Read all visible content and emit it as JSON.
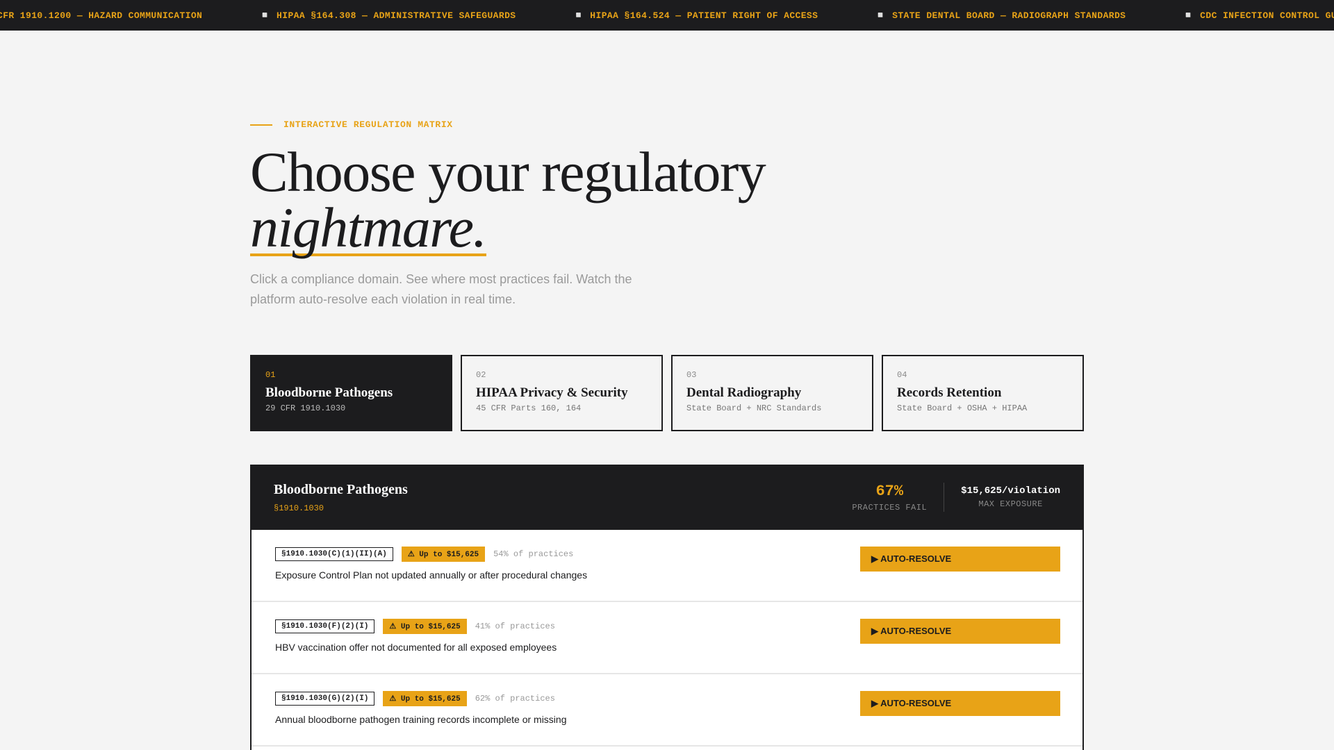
{
  "ticker": {
    "items": [
      "CFR 1910.1200 — HAZARD COMMUNICATION",
      "◽ HIPAA §164.308 — ADMINISTRATIVE SAFEGUARDS",
      "◽ HIPAA §164.524 — PATIENT RIGHT OF ACCESS",
      "◽ STATE DENTAL BOARD — RADIOGRAPH STANDARDS",
      "◽ CDC INFECTION CONTROL GU"
    ]
  },
  "hero": {
    "eyebrow": "INTERACTIVE REGULATION MATRIX",
    "headline_line1": "Choose your regulatory",
    "headline_line2": "nightmare.",
    "subtitle": "Click a compliance domain. See where most practices fail. Watch the platform auto-resolve each violation in real time."
  },
  "tabs": [
    {
      "num": "01",
      "name": "Bloodborne Pathogens",
      "cite": "29 CFR 1910.1030",
      "active": true
    },
    {
      "num": "02",
      "name": "HIPAA Privacy & Security",
      "cite": "45 CFR Parts 160, 164",
      "active": false
    },
    {
      "num": "03",
      "name": "Dental Radiography",
      "cite": "State Board + NRC Standards",
      "active": false
    },
    {
      "num": "04",
      "name": "Records Retention",
      "cite": "State Board + OSHA + HIPAA",
      "active": false
    }
  ],
  "panel": {
    "title": "Bloodborne Pathogens",
    "cite": "§1910.1030",
    "fail_rate": "67%",
    "fail_label": "PRACTICES FAIL",
    "exposure": "$15,625/violation",
    "exposure_label": "MAX EXPOSURE",
    "violations": [
      {
        "code": "§1910.1030(C)(1)(II)(A)",
        "fine": "⚠ Up to $15,625",
        "pct": "54% of practices",
        "desc": "Exposure Control Plan not updated annually or after procedural changes",
        "action": "▶ AUTO-RESOLVE"
      },
      {
        "code": "§1910.1030(F)(2)(I)",
        "fine": "⚠ Up to $15,625",
        "pct": "41% of practices",
        "desc": "HBV vaccination offer not documented for all exposed employees",
        "action": "▶ AUTO-RESOLVE"
      },
      {
        "code": "§1910.1030(G)(2)(I)",
        "fine": "⚠ Up to $15,625",
        "pct": "62% of practices",
        "desc": "Annual bloodborne pathogen training records incomplete or missing",
        "action": "▶ AUTO-RESOLVE"
      }
    ]
  },
  "colors": {
    "accent": "#e8a317",
    "dark": "#1c1c1e",
    "background": "#f4f4f4"
  }
}
